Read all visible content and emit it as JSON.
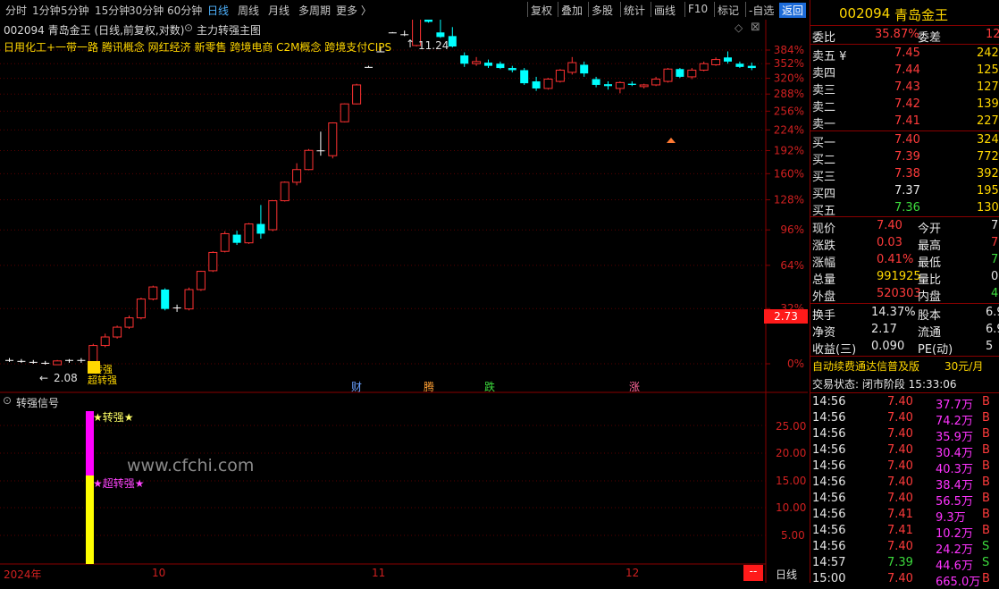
{
  "toolbar": {
    "items": [
      "分时",
      "1分钟",
      "5分钟",
      "15分钟",
      "30分钟",
      "60分钟",
      "日线",
      "周线",
      "月线",
      "多周期",
      "更多 〉"
    ],
    "active": "日线",
    "right_items": [
      "复权",
      "叠加",
      "多股",
      "统计",
      "画线",
      "F10",
      "标记",
      "-自选"
    ],
    "return_label": "返回"
  },
  "chart": {
    "header": "002094 青岛金王 (日线,前复权,对数)",
    "indicator_name": "主力转强主图",
    "concepts": "日用化工+一带一路 腾讯概念 网红经济 新零售 跨境电商 C2M概念 跨境支付CIPS",
    "high_label": "11.24",
    "low_label": "2.08",
    "price_tag": "2.73",
    "y_ticks": [
      "384%",
      "352%",
      "320%",
      "288%",
      "256%",
      "224%",
      "192%",
      "160%",
      "128%",
      "96%",
      "64%",
      "32%",
      "0%"
    ],
    "event_marks": [
      "财",
      "腾",
      "跌",
      "涨"
    ],
    "signal_labels": [
      "转强",
      "超转强"
    ]
  },
  "indicator": {
    "name": "转强信号",
    "y_ticks": [
      "25.00",
      "20.00",
      "15.00",
      "10.00",
      "5.00"
    ],
    "labels": [
      "★转强★",
      "★超转强★"
    ],
    "watermark": "www.cfchi.com",
    "x_labels": [
      "2024年",
      "10",
      "11",
      "12"
    ],
    "period": "日线",
    "dash": "--"
  },
  "quote": {
    "code": "002094",
    "name": "青岛金王",
    "weibi_label": "委比",
    "weibi": "35.87%",
    "weicha_label": "委差",
    "weicha": "12",
    "asks": [
      {
        "label": "卖五 ¥",
        "price": "7.45",
        "vol": "242"
      },
      {
        "label": "卖四",
        "price": "7.44",
        "vol": "125"
      },
      {
        "label": "卖三",
        "price": "7.43",
        "vol": "127"
      },
      {
        "label": "卖二",
        "price": "7.42",
        "vol": "139"
      },
      {
        "label": "卖一",
        "price": "7.41",
        "vol": "227"
      }
    ],
    "bids": [
      {
        "label": "买一",
        "price": "7.40",
        "vol": "324"
      },
      {
        "label": "买二",
        "price": "7.39",
        "vol": "772"
      },
      {
        "label": "买三",
        "price": "7.38",
        "vol": "392"
      },
      {
        "label": "买四",
        "price": "7.37",
        "vol": "195"
      },
      {
        "label": "买五",
        "price": "7.36",
        "vol": "130"
      }
    ],
    "stats": [
      {
        "l1": "现价",
        "v1": "7.40",
        "l2": "今开",
        "v2": "7"
      },
      {
        "l1": "涨跌",
        "v1": "0.03",
        "l2": "最高",
        "v2": "7"
      },
      {
        "l1": "涨幅",
        "v1": "0.41%",
        "l2": "最低",
        "v2": "7"
      },
      {
        "l1": "总量",
        "v1": "991925",
        "l2": "量比",
        "v2": "0"
      },
      {
        "l1": "外盘",
        "v1": "520303",
        "l2": "内盘",
        "v2": "471"
      }
    ],
    "stats2": [
      {
        "l1": "换手",
        "v1": "14.37%",
        "l2": "股本",
        "v2": "6.9"
      },
      {
        "l1": "净资",
        "v1": "2.17",
        "l2": "流通",
        "v2": "6.9"
      },
      {
        "l1": "收益(三)",
        "v1": "0.090",
        "l2": "PE(动)",
        "v2": "5"
      }
    ],
    "ad": "自动续费通达信普及版",
    "ad_price": "30元/月",
    "status": "交易状态: 闭市阶段 15:33:06",
    "ticks": [
      {
        "t": "14:56",
        "p": "7.40",
        "v": "37.7万",
        "bs": "B"
      },
      {
        "t": "14:56",
        "p": "7.40",
        "v": "74.2万",
        "bs": "B"
      },
      {
        "t": "14:56",
        "p": "7.40",
        "v": "35.9万",
        "bs": "B"
      },
      {
        "t": "14:56",
        "p": "7.40",
        "v": "30.4万",
        "bs": "B"
      },
      {
        "t": "14:56",
        "p": "7.40",
        "v": "40.3万",
        "bs": "B"
      },
      {
        "t": "14:56",
        "p": "7.40",
        "v": "38.4万",
        "bs": "B"
      },
      {
        "t": "14:56",
        "p": "7.40",
        "v": "56.5万",
        "bs": "B"
      },
      {
        "t": "14:56",
        "p": "7.41",
        "v": "9.3万",
        "bs": "B"
      },
      {
        "t": "14:56",
        "p": "7.41",
        "v": "10.2万",
        "bs": "B"
      },
      {
        "t": "14:56",
        "p": "7.40",
        "v": "24.2万",
        "bs": "S"
      },
      {
        "t": "14:57",
        "p": "7.39",
        "v": "44.6万",
        "bs": "S"
      },
      {
        "t": "15:00",
        "p": "7.40",
        "v": "665.0万",
        "bs": "B"
      }
    ]
  },
  "candles": [
    {
      "o": 2.12,
      "h": 2.14,
      "l": 2.1,
      "c": 2.11
    },
    {
      "o": 2.11,
      "h": 2.13,
      "l": 2.09,
      "c": 2.1
    },
    {
      "o": 2.1,
      "h": 2.12,
      "l": 2.08,
      "c": 2.09
    },
    {
      "o": 2.09,
      "h": 2.11,
      "l": 2.07,
      "c": 2.07
    },
    {
      "o": 2.07,
      "h": 2.12,
      "l": 2.07,
      "c": 2.11
    },
    {
      "o": 2.11,
      "h": 2.13,
      "l": 2.09,
      "c": 2.12
    },
    {
      "o": 2.12,
      "h": 2.14,
      "l": 2.09,
      "c": 2.1
    },
    {
      "o": 2.1,
      "h": 2.3,
      "l": 2.08,
      "c": 2.28
    },
    {
      "o": 2.28,
      "h": 2.42,
      "l": 2.26,
      "c": 2.38
    },
    {
      "o": 2.38,
      "h": 2.52,
      "l": 2.36,
      "c": 2.5
    },
    {
      "o": 2.5,
      "h": 2.65,
      "l": 2.48,
      "c": 2.62
    },
    {
      "o": 2.62,
      "h": 2.9,
      "l": 2.6,
      "c": 2.88
    },
    {
      "o": 2.88,
      "h": 3.08,
      "l": 2.86,
      "c": 3.06
    },
    {
      "o": 3.02,
      "h": 3.04,
      "l": 2.72,
      "c": 2.74
    },
    {
      "o": 2.76,
      "h": 2.8,
      "l": 2.7,
      "c": 2.74
    },
    {
      "o": 2.74,
      "h": 3.05,
      "l": 2.72,
      "c": 3.02
    },
    {
      "o": 3.02,
      "h": 3.32,
      "l": 3.0,
      "c": 3.31
    },
    {
      "o": 3.32,
      "h": 3.66,
      "l": 3.3,
      "c": 3.64
    },
    {
      "o": 3.66,
      "h": 4.05,
      "l": 3.64,
      "c": 4.0
    },
    {
      "o": 3.98,
      "h": 4.06,
      "l": 3.78,
      "c": 3.82
    },
    {
      "o": 3.82,
      "h": 4.22,
      "l": 3.8,
      "c": 4.2
    },
    {
      "o": 4.2,
      "h": 4.62,
      "l": 3.9,
      "c": 4.0
    },
    {
      "o": 4.08,
      "h": 4.72,
      "l": 4.05,
      "c": 4.72
    },
    {
      "o": 4.72,
      "h": 5.2,
      "l": 4.7,
      "c": 5.18
    },
    {
      "o": 5.18,
      "h": 5.7,
      "l": 5.1,
      "c": 5.52
    },
    {
      "o": 5.52,
      "h": 6.12,
      "l": 5.5,
      "c": 6.08
    },
    {
      "o": 6.08,
      "h": 6.68,
      "l": 5.92,
      "c": 6.08
    },
    {
      "o": 5.92,
      "h": 7.0,
      "l": 5.84,
      "c": 6.98
    },
    {
      "o": 7.02,
      "h": 7.7,
      "l": 7.0,
      "c": 7.68
    },
    {
      "o": 7.68,
      "h": 8.5,
      "l": 7.66,
      "c": 8.45
    },
    {
      "o": 9.25,
      "h": 9.3,
      "l": 9.22,
      "c": 9.25
    },
    {
      "o": 9.98,
      "h": 10.25,
      "l": 9.96,
      "c": 10.0
    },
    {
      "o": 11.0,
      "h": 11.02,
      "l": 10.98,
      "c": 11.0
    },
    {
      "o": 10.9,
      "h": 11.1,
      "l": 10.8,
      "c": 10.88
    },
    {
      "o": 10.3,
      "h": 12.1,
      "l": 10.25,
      "c": 12.0
    },
    {
      "o": 11.85,
      "h": 12.45,
      "l": 11.55,
      "c": 11.6
    },
    {
      "o": 11.0,
      "h": 12.0,
      "l": 10.7,
      "c": 10.75
    },
    {
      "o": 10.8,
      "h": 11.3,
      "l": 10.2,
      "c": 10.25
    },
    {
      "o": 9.8,
      "h": 9.95,
      "l": 9.25,
      "c": 9.4
    },
    {
      "o": 9.4,
      "h": 9.72,
      "l": 9.3,
      "c": 9.5
    },
    {
      "o": 9.45,
      "h": 9.6,
      "l": 9.2,
      "c": 9.3
    },
    {
      "o": 9.4,
      "h": 9.5,
      "l": 9.15,
      "c": 9.2
    },
    {
      "o": 9.2,
      "h": 9.3,
      "l": 9.0,
      "c": 9.1
    },
    {
      "o": 9.1,
      "h": 9.2,
      "l": 8.45,
      "c": 8.52
    },
    {
      "o": 8.6,
      "h": 8.8,
      "l": 8.2,
      "c": 8.3
    },
    {
      "o": 8.3,
      "h": 8.75,
      "l": 8.25,
      "c": 8.7
    },
    {
      "o": 8.6,
      "h": 9.15,
      "l": 8.55,
      "c": 9.1
    },
    {
      "o": 9.0,
      "h": 9.72,
      "l": 8.9,
      "c": 9.45
    },
    {
      "o": 9.35,
      "h": 9.5,
      "l": 8.8,
      "c": 8.95
    },
    {
      "o": 8.7,
      "h": 8.8,
      "l": 8.35,
      "c": 8.45
    },
    {
      "o": 8.48,
      "h": 8.6,
      "l": 8.25,
      "c": 8.4
    },
    {
      "o": 8.3,
      "h": 8.6,
      "l": 8.1,
      "c": 8.55
    },
    {
      "o": 8.5,
      "h": 8.6,
      "l": 8.4,
      "c": 8.45
    },
    {
      "o": 8.38,
      "h": 8.5,
      "l": 8.3,
      "c": 8.45
    },
    {
      "o": 8.45,
      "h": 8.8,
      "l": 8.4,
      "c": 8.7
    },
    {
      "o": 8.6,
      "h": 9.2,
      "l": 8.55,
      "c": 9.15
    },
    {
      "o": 9.15,
      "h": 9.2,
      "l": 8.75,
      "c": 8.8
    },
    {
      "o": 8.8,
      "h": 9.2,
      "l": 8.7,
      "c": 9.1
    },
    {
      "o": 9.1,
      "h": 9.5,
      "l": 9.05,
      "c": 9.4
    },
    {
      "o": 9.35,
      "h": 9.7,
      "l": 9.3,
      "c": 9.6
    },
    {
      "o": 9.7,
      "h": 10.0,
      "l": 9.4,
      "c": 9.5
    },
    {
      "o": 9.4,
      "h": 9.5,
      "l": 9.2,
      "c": 9.25
    },
    {
      "o": 9.3,
      "h": 9.45,
      "l": 9.1,
      "c": 9.2
    }
  ],
  "signals": {
    "index": 7,
    "zhuanqiang": 28,
    "chaozhuanqiang": 15
  }
}
